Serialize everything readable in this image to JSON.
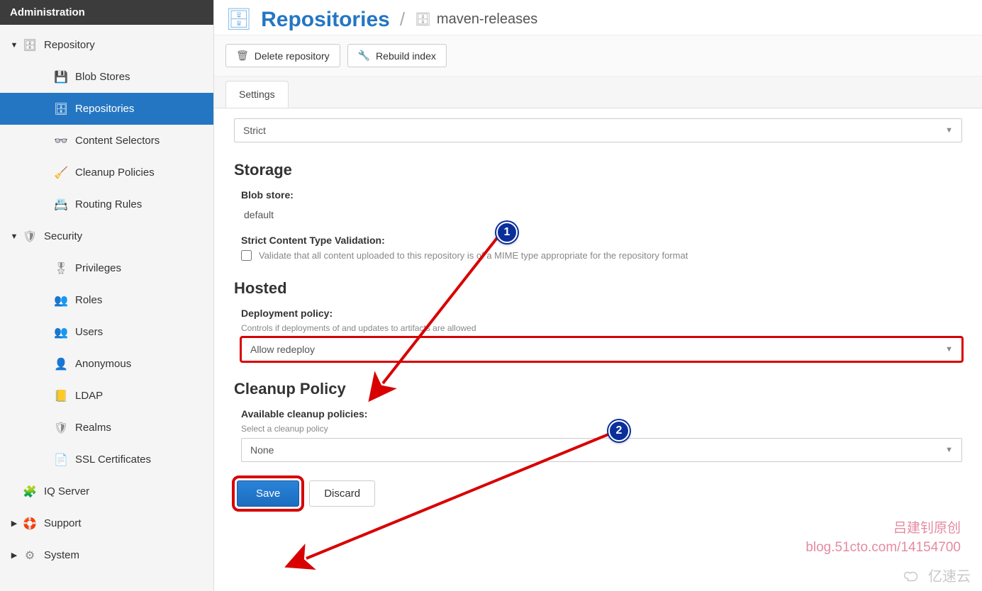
{
  "sidebar": {
    "header": "Administration",
    "groups": [
      {
        "label": "Repository",
        "icon": "🗄",
        "items": [
          {
            "label": "Blob Stores",
            "icon": "💾"
          },
          {
            "label": "Repositories",
            "icon": "🗄",
            "selected": true
          },
          {
            "label": "Content Selectors",
            "icon": "👓"
          },
          {
            "label": "Cleanup Policies",
            "icon": "🧹"
          },
          {
            "label": "Routing Rules",
            "icon": "📇"
          }
        ]
      },
      {
        "label": "Security",
        "icon": "🛡",
        "items": [
          {
            "label": "Privileges",
            "icon": "🎖"
          },
          {
            "label": "Roles",
            "icon": "👥"
          },
          {
            "label": "Users",
            "icon": "👥"
          },
          {
            "label": "Anonymous",
            "icon": "👤"
          },
          {
            "label": "LDAP",
            "icon": "📒"
          },
          {
            "label": "Realms",
            "icon": "🛡"
          },
          {
            "label": "SSL Certificates",
            "icon": "📄"
          }
        ]
      },
      {
        "label": "IQ Server",
        "icon": "🧩",
        "items": []
      },
      {
        "label": "Support",
        "icon": "🛟",
        "items": [],
        "caret": "▶"
      },
      {
        "label": "System",
        "icon": "⚙",
        "items": [],
        "caret": "▶"
      }
    ]
  },
  "header": {
    "title": "Repositories",
    "sep": "/",
    "sub": "maven-releases"
  },
  "toolbar": {
    "delete": "Delete repository",
    "rebuild": "Rebuild index"
  },
  "tabs": {
    "settings": "Settings"
  },
  "form": {
    "strict_combo": "Strict",
    "storage": {
      "heading": "Storage",
      "blob_label": "Blob store:",
      "blob_value": "default",
      "sctv_label": "Strict Content Type Validation:",
      "sctv_desc": "Validate that all content uploaded to this repository is of a MIME type appropriate for the repository format"
    },
    "hosted": {
      "heading": "Hosted",
      "dp_label": "Deployment policy:",
      "dp_desc": "Controls if deployments of and updates to artifacts are allowed",
      "dp_value": "Allow redeploy"
    },
    "cleanup": {
      "heading": "Cleanup Policy",
      "acp_label": "Available cleanup policies:",
      "acp_desc": "Select a cleanup policy",
      "acp_value": "None"
    },
    "actions": {
      "save": "Save",
      "discard": "Discard"
    }
  },
  "annotations": {
    "bubble1": "1",
    "bubble2": "2",
    "wm_line1": "吕建钊原创",
    "wm_line2": "blog.51cto.com/14154700",
    "wm_brand": "亿速云"
  }
}
